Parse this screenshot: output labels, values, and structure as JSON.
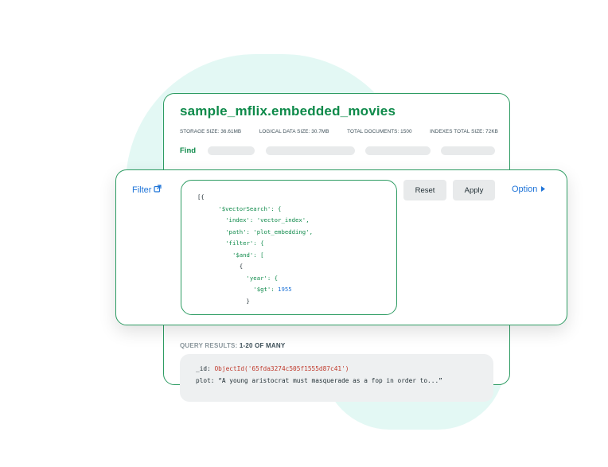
{
  "collection": {
    "title": "sample_mflix.embedded_movies",
    "stats": [
      "STORAGE SIZE: 36.61MB",
      "LOGICAL DATA SIZE: 30.7MB",
      "TOTAL DOCUMENTS: 1500",
      "INDEXES TOTAL SIZE: 72KB"
    ],
    "find_label": "Find"
  },
  "filter_bar": {
    "filter_label": "Filter",
    "reset_label": "Reset",
    "apply_label": "Apply",
    "option_label": "Option"
  },
  "query": {
    "lines": [
      "[{",
      "'$vectorSearch': {",
      "'index': 'vector_index',",
      "'path': 'plot_embedding',",
      "'filter': {",
      "'$and': [",
      "{",
      "'year': {",
      "'$gt': 1955",
      "}"
    ]
  },
  "results": {
    "label_prefix": "QUERY RESULTS:",
    "label_range": "1-20 OF MANY",
    "doc": {
      "id_key": "_id:",
      "id_value": "ObjectId('65fda3274c505f1555d87c41')",
      "plot_key": "plot:",
      "plot_value": "“A young aristocrat must masquerade as a fop in order to...”"
    }
  },
  "colors": {
    "accent_green": "#0e8a4a",
    "border_green": "#2e9c63",
    "link_blue": "#1f74d8",
    "blob_mint": "#e3f8f4"
  },
  "icons": {
    "filter": "external-link-icon",
    "option": "caret-right-icon"
  }
}
